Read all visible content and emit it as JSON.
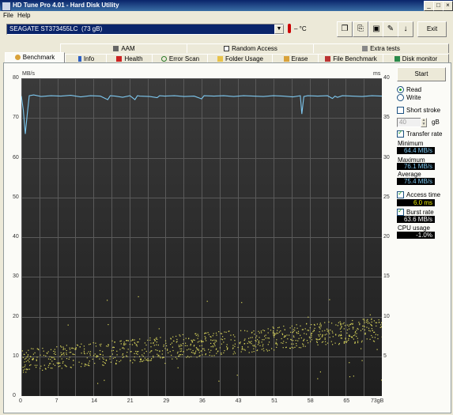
{
  "window": {
    "title": "HD Tune Pro 4.01 - Hard Disk Utility",
    "minimize": "_",
    "maximize": "□",
    "close": "×"
  },
  "menu": [
    "File",
    "Help"
  ],
  "drive": {
    "name": "SEAGATE ST373455LC",
    "size": "(73 gB)"
  },
  "temperature": "– °C",
  "exit_label": "Exit",
  "tabs_top": [
    "AAM",
    "Random Access",
    "Extra tests"
  ],
  "tabs_bottom": [
    "Benchmark",
    "Info",
    "Health",
    "Error Scan",
    "Folder Usage",
    "Erase",
    "File Benchmark",
    "Disk monitor"
  ],
  "controls": {
    "start_label": "Start",
    "read_label": "Read",
    "write_label": "Write",
    "short_stroke_label": "Short stroke",
    "short_stroke_value": "40",
    "short_stroke_unit": "gB",
    "transfer_rate_label": "Transfer rate",
    "minimum_label": "Minimum",
    "minimum_value": "64.4 MB/s",
    "maximum_label": "Maximum",
    "maximum_value": "76.1 MB/s",
    "average_label": "Average",
    "average_value": "75.4 MB/s",
    "access_time_label": "Access time",
    "access_time_value": "6.0 ms",
    "burst_rate_label": "Burst rate",
    "burst_rate_value": "63.6 MB/s",
    "cpu_usage_label": "CPU usage",
    "cpu_usage_value": "-1.0%"
  },
  "colors": {
    "transfer": "#7ec8f0",
    "access": "#d8d45a",
    "minimum": "#7ec8f0",
    "maximum": "#7ec8f0",
    "average": "#7ec8f0",
    "access_val": "#f0f000",
    "burst": "#ffffff",
    "cpu": "#ffffff"
  },
  "chart_data": {
    "type": "line",
    "x_unit": "73gB",
    "y_left_unit": "MB/s",
    "y_right_unit": "ms",
    "x_ticks": [
      "0",
      "7",
      "14",
      "21",
      "29",
      "36",
      "43",
      "51",
      "58",
      "65",
      "73gB"
    ],
    "y_left_ticks": [
      "80",
      "70",
      "60",
      "50",
      "40",
      "30",
      "20",
      "10",
      "0"
    ],
    "y_right_ticks": [
      "40",
      "35",
      "30",
      "25",
      "20",
      "15",
      "10",
      "5",
      ""
    ],
    "xlim": [
      0,
      73
    ],
    "ylim_left": [
      0,
      80
    ],
    "ylim_right": [
      0,
      40
    ],
    "grid": true,
    "series": [
      {
        "name": "Transfer rate",
        "x": [
          0,
          0.4,
          0.8,
          1.2,
          1.6,
          2.5,
          4,
          6,
          8,
          10,
          12,
          14,
          16,
          17.5,
          18,
          19,
          20.5,
          22,
          23,
          23.5,
          24,
          26,
          27.5,
          28,
          29,
          31,
          33,
          35,
          36.5,
          37,
          39,
          41,
          43,
          45,
          47,
          49,
          51,
          53,
          55,
          56.5,
          56.8,
          57.2,
          58,
          60,
          62,
          63,
          63.5,
          64,
          65,
          67,
          69,
          71,
          73
        ],
        "y": [
          75.5,
          72,
          66,
          71,
          75.6,
          75.8,
          75.4,
          75.6,
          75.5,
          75.7,
          75.3,
          75.6,
          75.5,
          74.6,
          75.6,
          75.5,
          75.2,
          75.6,
          74.6,
          75.6,
          75.5,
          75.4,
          75.1,
          75.6,
          75.5,
          75.6,
          75.4,
          75.5,
          74.8,
          75.6,
          75.5,
          75.6,
          75.4,
          75.6,
          75.5,
          75.4,
          75.6,
          75.5,
          75.3,
          75.6,
          71,
          75.4,
          75.6,
          75.5,
          75.6,
          74.9,
          75.5,
          75.2,
          75.6,
          75.5,
          75.4,
          75.6,
          75.5
        ]
      },
      {
        "name": "Access time",
        "scatter_ms_range_start": [
          3,
          6
        ],
        "scatter_ms_range_end": [
          7,
          10
        ]
      }
    ]
  }
}
